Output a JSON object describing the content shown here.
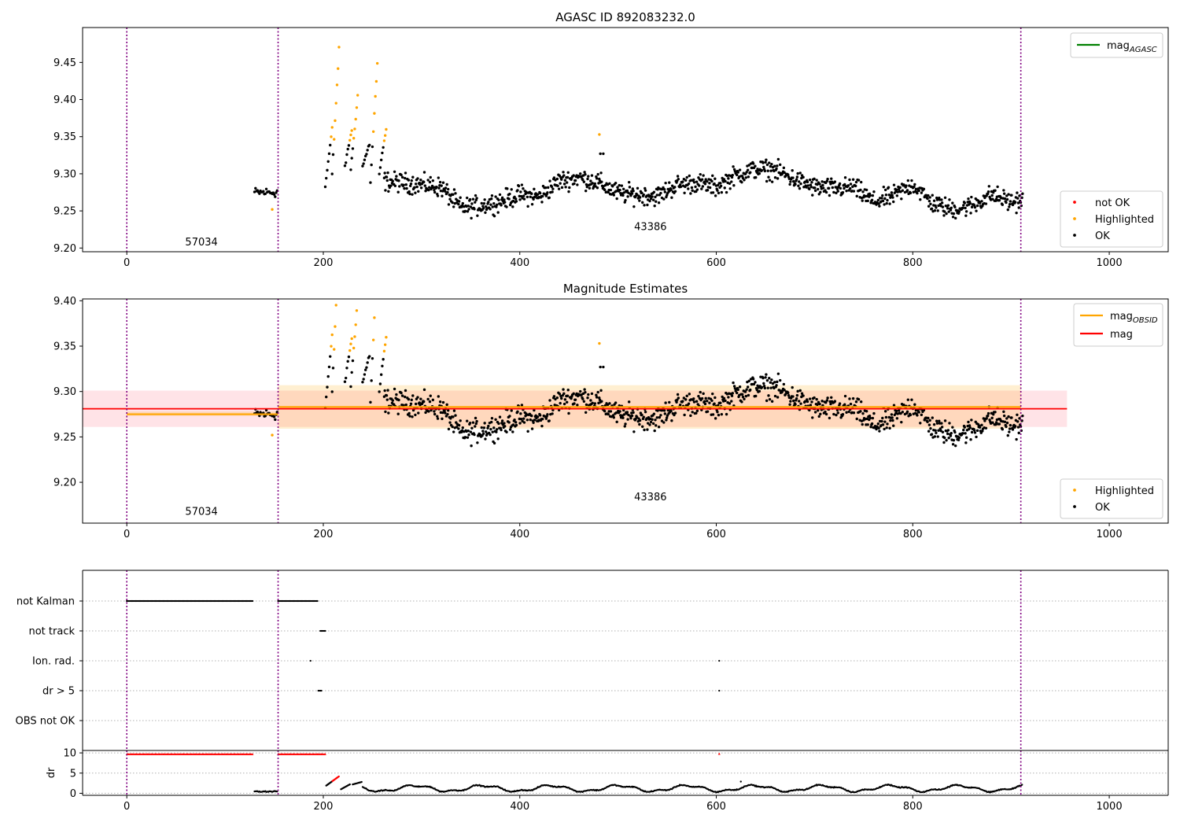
{
  "figure": {
    "main_title": "AGASC ID 892083232.0",
    "mag_title": "Magnitude Estimates"
  },
  "chart_data": [
    {
      "type": "scatter",
      "panel": "top",
      "title": "AGASC ID 892083232.0",
      "xlim": [
        -45,
        1060
      ],
      "ylim": [
        9.195,
        9.497
      ],
      "xticks": [
        0,
        200,
        400,
        600,
        800,
        1000
      ],
      "yticks": [
        9.2,
        9.25,
        9.3,
        9.35,
        9.4,
        9.45
      ],
      "grid": false,
      "obsid_boundaries": [
        0,
        154,
        910
      ],
      "obsid_labels": [
        {
          "text": "57034",
          "x": 76,
          "y": 9.208
        },
        {
          "text": "43386",
          "x": 533,
          "y": 9.229
        }
      ],
      "legend_lines": [
        {
          "label": "mag",
          "sub": "AGASC",
          "color": "#008000"
        }
      ],
      "legend_points": [
        {
          "label": "not OK",
          "color": "#ff0000"
        },
        {
          "label": "Highlighted",
          "color": "#ffa500"
        },
        {
          "label": "OK",
          "color": "#000000"
        }
      ],
      "legend_placement": {
        "lines": "top-right",
        "points": "bottom-right"
      }
    },
    {
      "type": "scatter",
      "panel": "middle",
      "title": "Magnitude Estimates",
      "xlim": [
        -45,
        1060
      ],
      "ylim": [
        9.155,
        9.402
      ],
      "xticks": [
        0,
        200,
        400,
        600,
        800,
        1000
      ],
      "yticks": [
        9.2,
        9.25,
        9.3,
        9.35,
        9.4
      ],
      "grid": false,
      "obsid_boundaries": [
        0,
        154,
        910
      ],
      "obsid_labels": [
        {
          "text": "57034",
          "x": 76,
          "y": 9.168
        },
        {
          "text": "43386",
          "x": 533,
          "y": 9.184
        }
      ],
      "mag_line": {
        "value": 9.281,
        "band": [
          9.261,
          9.301
        ],
        "x": [
          -45,
          957
        ],
        "color": "#ff0000"
      },
      "mag_obsid": [
        {
          "x": [
            0,
            154
          ],
          "value": 9.275,
          "band": [
            9.273,
            9.278
          ]
        },
        {
          "x": [
            154,
            910
          ],
          "value": 9.283,
          "band": [
            9.259,
            9.307
          ]
        }
      ],
      "legend_lines": [
        {
          "label": "mag",
          "sub": "OBSID",
          "color": "#ffa500"
        },
        {
          "label": "mag",
          "sub": "",
          "color": "#ff0000"
        }
      ],
      "legend_points": [
        {
          "label": "Highlighted",
          "color": "#ffa500"
        },
        {
          "label": "OK",
          "color": "#000000"
        }
      ],
      "legend_placement": {
        "lines": "top-right",
        "points": "bottom-right"
      }
    },
    {
      "type": "scatter",
      "panel": "flags",
      "xlim": [
        -45,
        1060
      ],
      "categories": [
        "not Kalman",
        "not track",
        "Ion. rad.",
        "dr > 5",
        "OBS not OK"
      ],
      "flags": [
        {
          "name": "not Kalman",
          "ranges": [
            [
              0,
              128
            ],
            [
              154,
              194
            ]
          ],
          "points": []
        },
        {
          "name": "not track",
          "ranges": [
            [
              197,
              202
            ]
          ],
          "points": []
        },
        {
          "name": "Ion. rad.",
          "ranges": [],
          "points": [
            187,
            603
          ]
        },
        {
          "name": "dr > 5",
          "ranges": [
            [
              195,
              198
            ]
          ],
          "points": [
            603
          ]
        },
        {
          "name": "OBS not OK",
          "ranges": [],
          "points": []
        }
      ],
      "grid": "horizontal dotted",
      "obsid_boundaries": [
        0,
        154,
        910
      ]
    },
    {
      "type": "scatter",
      "panel": "dr",
      "ylabel": "dr",
      "xlim": [
        -45,
        1060
      ],
      "ylim": [
        -0.5,
        10.6
      ],
      "xticks": [
        0,
        200,
        400,
        600,
        800,
        1000
      ],
      "yticks": [
        0,
        5,
        10
      ],
      "red_at_10": [
        [
          0,
          128
        ],
        [
          154,
          202
        ]
      ],
      "red_single": [
        603
      ],
      "red_ramp": {
        "x": [
          203,
          216
        ],
        "y": [
          1.9,
          4.2
        ]
      },
      "grid": "horizontal dotted",
      "obsid_boundaries": [
        0,
        154,
        910
      ]
    }
  ]
}
